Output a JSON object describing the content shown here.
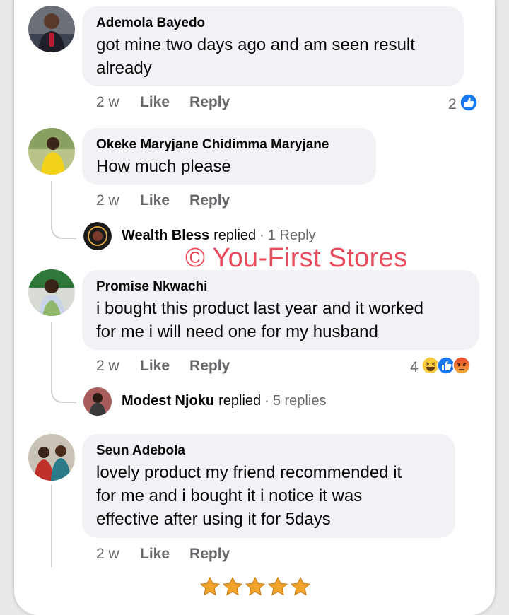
{
  "comments": [
    {
      "name": "Ademola Bayedo",
      "text_lines": [
        "got mine two days ago and am seen result",
        "already"
      ],
      "time": "2 w",
      "like": "Like",
      "reply": "Reply",
      "reaction_count": "2"
    },
    {
      "name": "Okeke Maryjane Chidimma Maryjane",
      "text_lines": [
        "How much please"
      ],
      "time": "2 w",
      "like": "Like",
      "reply": "Reply",
      "replied": {
        "name": "Wealth Bless",
        "word": "replied",
        "sep": "·",
        "count": "1 Reply"
      }
    },
    {
      "name": "Promise Nkwachi",
      "text_lines": [
        "i bought this product last year and it worked",
        "for me i will need one for my husband"
      ],
      "time": "2 w",
      "like": "Like",
      "reply": "Reply",
      "reaction_count": "4",
      "replied": {
        "name": "Modest Njoku",
        "word": "replied",
        "sep": "·",
        "count": "5 replies"
      }
    },
    {
      "name": "Seun Adebola",
      "text_lines": [
        "lovely product my friend recommended it",
        "for me and i bought it i notice it was",
        "effective after using it for 5days"
      ],
      "time": "2 w",
      "like": "Like",
      "reply": "Reply"
    }
  ],
  "watermark": "© You-First Stores",
  "rating": {
    "stars": 5,
    "max": 5
  },
  "colors": {
    "bubble": "#f0f2f5",
    "like_blue": "#1877f2",
    "watermark": "#e84b5b",
    "star": "#f0a32a"
  }
}
